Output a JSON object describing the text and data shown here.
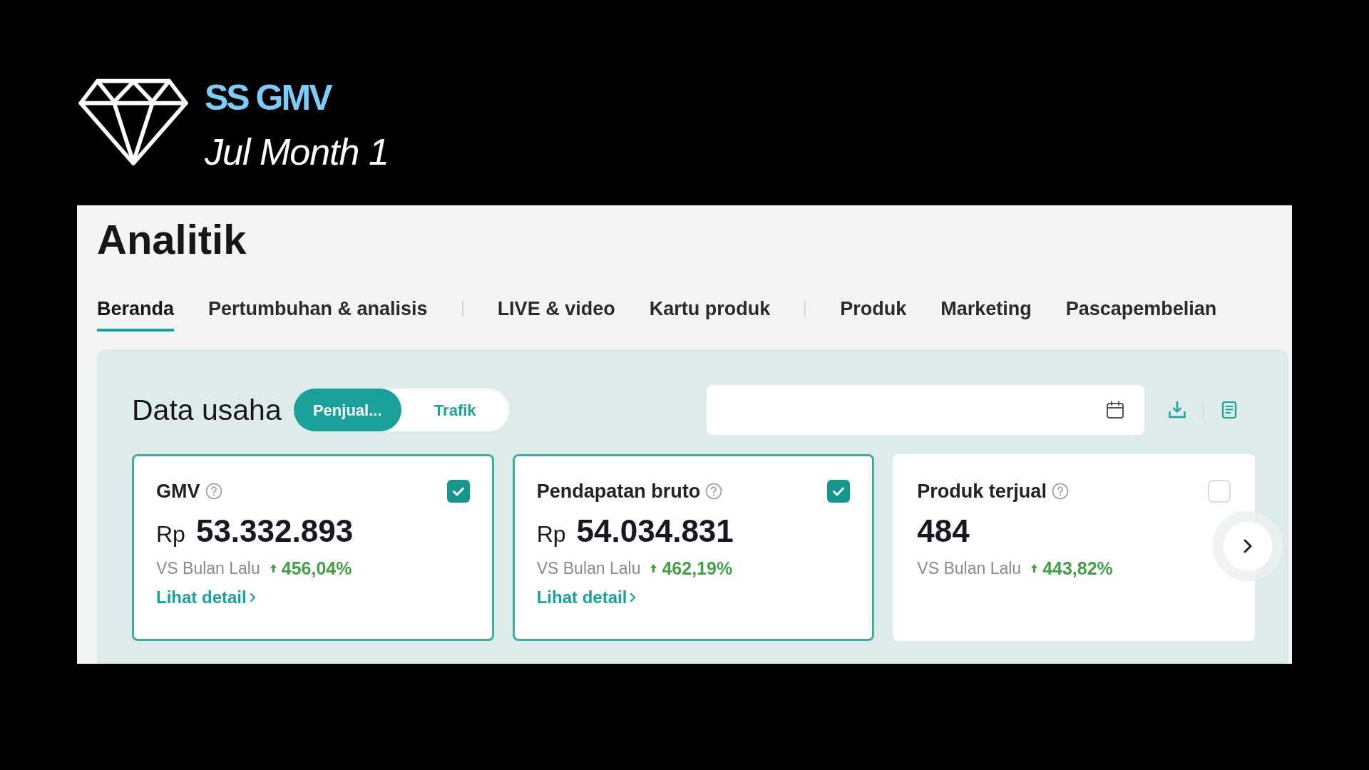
{
  "brand": {
    "title": "SS GMV",
    "subtitle": "Jul Month 1"
  },
  "page": {
    "title": "Analitik"
  },
  "tab_groups": [
    {
      "tabs": [
        {
          "label": "Beranda",
          "selected": true
        },
        {
          "label": "Pertumbuhan & analisis",
          "selected": false
        }
      ]
    },
    {
      "tabs": [
        {
          "label": "LIVE & video",
          "selected": false
        },
        {
          "label": "Kartu produk",
          "selected": false
        }
      ]
    },
    {
      "tabs": [
        {
          "label": "Produk",
          "selected": false
        },
        {
          "label": "Marketing",
          "selected": false
        },
        {
          "label": "Pascapembelian",
          "selected": false
        }
      ]
    }
  ],
  "data_section": {
    "title": "Data usaha",
    "segments": [
      {
        "label": "Penjual...",
        "selected": true
      },
      {
        "label": "Trafik",
        "selected": false
      }
    ]
  },
  "metrics": [
    {
      "title": "GMV",
      "currency": "Rp",
      "value": "53.332.893",
      "comparison": "VS Bulan Lalu",
      "rising": true,
      "change": "456,04%",
      "checked": true,
      "link": "Lihat detail"
    },
    {
      "title": "Pendapatan bruto",
      "currency": "Rp",
      "value": "54.034.831",
      "comparison": "VS Bulan Lalu",
      "rising": true,
      "change": "462,19%",
      "checked": true,
      "link": "Lihat detail"
    },
    {
      "title": "Produk terjual",
      "value": "484",
      "comparison": "VS Bulan Lalu",
      "rising": true,
      "change": "443,82%",
      "checked": false
    }
  ]
}
